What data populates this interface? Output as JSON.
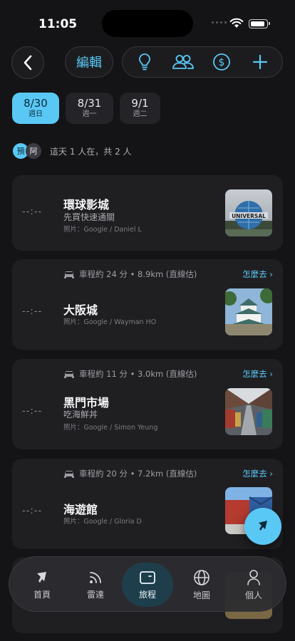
{
  "status": {
    "time": "11:05"
  },
  "toolbar": {
    "edit_label": "編輯"
  },
  "dates": [
    {
      "date": "8/30",
      "weekday": "週日"
    },
    {
      "date": "8/31",
      "weekday": "週一"
    },
    {
      "date": "9/1",
      "weekday": "週二"
    }
  ],
  "presence": {
    "avatar1": "預",
    "avatar2": "阿",
    "text": "這天 1 人在，共 2 人"
  },
  "stops": [
    {
      "time": "--:--",
      "title": "環球影城",
      "note": "先買快速通關",
      "credit": "照片：Google / Daniel L"
    },
    {
      "time": "--:--",
      "drive": "車程約 24 分 • 8.9km (直線估)",
      "how": "怎麼去 ›",
      "title": "大阪城",
      "credit": "照片：Google / Wayman HO"
    },
    {
      "time": "--:--",
      "drive": "車程約 11 分 • 3.0km (直線估)",
      "how": "怎麼去 ›",
      "title": "黑門市場",
      "note": "吃海鮮丼",
      "credit": "照片：Google / Simon Yeung"
    },
    {
      "time": "--:--",
      "drive": "車程約 20 分 • 7.2km (直線估)",
      "how": "怎麼去 ›",
      "title": "海遊館",
      "credit": "照片：Google / Gloria D"
    }
  ],
  "nav": [
    {
      "label": "首頁",
      "icon": "home-logo-icon"
    },
    {
      "label": "雷達",
      "icon": "radar-icon"
    },
    {
      "label": "旅程",
      "icon": "trip-icon"
    },
    {
      "label": "地圖",
      "icon": "globe-icon"
    },
    {
      "label": "個人",
      "icon": "person-icon"
    }
  ],
  "colors": {
    "accent": "#5ac8f5",
    "background": "#141416",
    "card": "#1f1f22"
  }
}
